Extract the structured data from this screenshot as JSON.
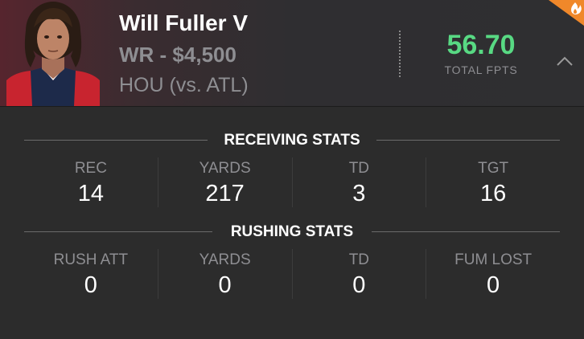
{
  "player": {
    "name": "Will Fuller V",
    "position_salary": "WR - $4,500",
    "matchup": "HOU (vs. ATL)"
  },
  "fpts": {
    "value": "56.70",
    "label": "TOTAL FPTS"
  },
  "icons": {
    "collapse": "chevron-up-icon",
    "hot": "flame-icon",
    "photo": "player-headshot"
  },
  "colors": {
    "fpts_value": "#58d983",
    "hot_badge": "#f0882a",
    "background": "#2c2c2c"
  },
  "receiving": {
    "title": "RECEIVING STATS",
    "stats": [
      {
        "label": "REC",
        "value": "14"
      },
      {
        "label": "YARDS",
        "value": "217"
      },
      {
        "label": "TD",
        "value": "3"
      },
      {
        "label": "TGT",
        "value": "16"
      }
    ]
  },
  "rushing": {
    "title": "RUSHING STATS",
    "stats": [
      {
        "label": "RUSH ATT",
        "value": "0"
      },
      {
        "label": "YARDS",
        "value": "0"
      },
      {
        "label": "TD",
        "value": "0"
      },
      {
        "label": "FUM LOST",
        "value": "0"
      }
    ]
  }
}
